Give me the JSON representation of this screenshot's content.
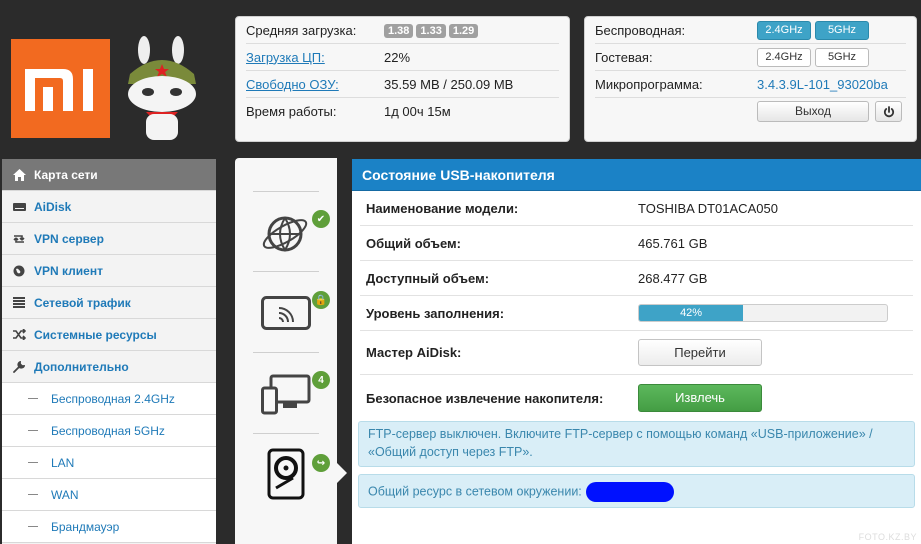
{
  "stats": {
    "load_label": "Средняя загрузка:",
    "load_values": [
      "1.38",
      "1.33",
      "1.29"
    ],
    "cpu_label": "Загрузка ЦП:",
    "cpu_value": "22%",
    "ram_label": "Свободно ОЗУ:",
    "ram_value": "35.59 MB / 250.09 MB",
    "uptime_label": "Время работы:",
    "uptime_value": "1д 00ч 15м"
  },
  "radio": {
    "wireless_label": "Беспроводная:",
    "guest_label": "Гостевая:",
    "band_24": "2.4GHz",
    "band_5": "5GHz",
    "firmware_label": "Микропрограмма:",
    "firmware_value": "3.4.3.9L-101_93020ba",
    "logout_label": "Выход"
  },
  "sidebar": {
    "items": [
      {
        "label": "Карта сети",
        "icon": "home-icon"
      },
      {
        "label": "AiDisk",
        "icon": "disk-icon"
      },
      {
        "label": "VPN сервер",
        "icon": "retweet-icon"
      },
      {
        "label": "VPN клиент",
        "icon": "globe-icon"
      },
      {
        "label": "Сетевой трафик",
        "icon": "list-icon"
      },
      {
        "label": "Системные ресурсы",
        "icon": "shuffle-icon"
      },
      {
        "label": "Дополнительно",
        "icon": "wrench-icon"
      }
    ],
    "subitems": [
      "Беспроводная 2.4GHz",
      "Беспроводная 5GHz",
      "LAN",
      "WAN",
      "Брандмауэр"
    ]
  },
  "mini": {
    "clients_count": "4"
  },
  "usb": {
    "title": "Состояние USB-накопителя",
    "model_label": "Наименование модели:",
    "model_value": "TOSHIBA DT01ACA050",
    "total_label": "Общий объем:",
    "total_value": "465.761 GB",
    "free_label": "Доступный объем:",
    "free_value": "268.477 GB",
    "usage_label": "Уровень заполнения:",
    "usage_percent": 42,
    "usage_text": "42%",
    "aidisk_label": "Мастер AiDisk:",
    "aidisk_button": "Перейти",
    "eject_label": "Безопасное извлечение накопителя:",
    "eject_button": "Извлечь",
    "ftp_notice": "FTP-сервер выключен. Включите FTP-сервер с помощью команд «USB-приложение» / «Общий доступ через FTP».",
    "share_notice": "Общий ресурс в сетевом окружении:"
  },
  "colors": {
    "accent": "#1b82c6",
    "band_active": "#3ea3c7",
    "eject_green": "#5cb85c",
    "logo_orange": "#f26a20"
  },
  "watermark": "FOTO.KZ.BY"
}
